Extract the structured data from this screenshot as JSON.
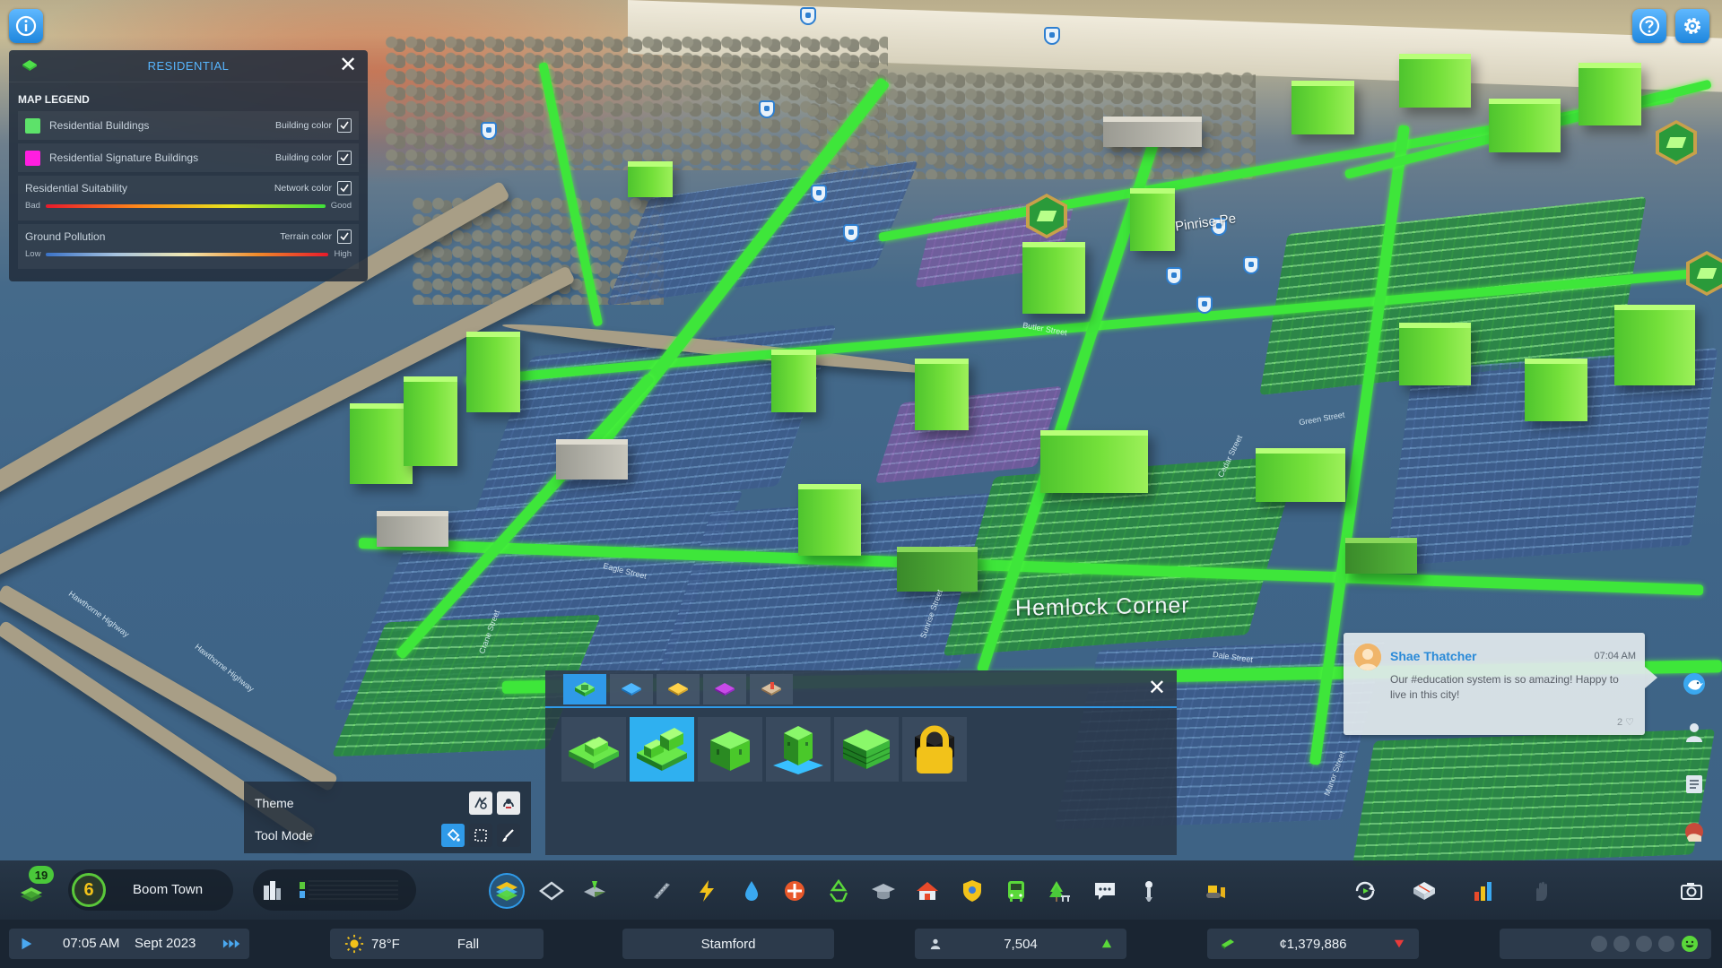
{
  "top_buttons": {
    "info_icon": "info-icon",
    "help_icon": "help-icon",
    "settings_icon": "gear-icon"
  },
  "legend": {
    "title": "RESIDENTIAL",
    "subtitle": "MAP LEGEND",
    "rows": [
      {
        "label": "Residential Buildings",
        "mode": "Building color",
        "color": "#5de26a",
        "checked": true
      },
      {
        "label": "Residential Signature Buildings",
        "mode": "Building color",
        "color": "#ff1ee0",
        "checked": true
      }
    ],
    "gradients": [
      {
        "label": "Residential Suitability",
        "mode": "Network color",
        "low": "Bad",
        "high": "Good",
        "checked": true
      },
      {
        "label": "Ground Pollution",
        "mode": "Terrain color",
        "low": "Low",
        "high": "High",
        "checked": true
      }
    ]
  },
  "map": {
    "district_name": "Hemlock Corner",
    "district_name_2": "Pinrise Pe",
    "streets": [
      "Hawthorne Highway",
      "Hawthorne Highway",
      "Eagle Street",
      "Crane Street",
      "Sunrise Street",
      "Dale Street",
      "Manor Street",
      "Green Street",
      "Butler Street",
      "Cedar Street"
    ]
  },
  "zone_panel": {
    "tabs": [
      "residential-zone-tab",
      "commercial-zone-tab",
      "industrial-zone-tab",
      "office-zone-tab",
      "special-zone-tab"
    ],
    "active_tab": 0,
    "items": [
      "low-density-housing",
      "medium-density-housing",
      "medium-density-row-housing",
      "mixed-housing",
      "high-density-housing",
      "locked-housing"
    ],
    "active_item": 1
  },
  "tool_options": {
    "theme_label": "Theme",
    "tool_mode_label": "Tool Mode"
  },
  "chirp": {
    "name": "Shae Thatcher",
    "time": "07:04 AM",
    "message": "Our #education system is so amazing! Happy to live in this city!",
    "likes": "2"
  },
  "toolbar": {
    "notification_count": "19",
    "milestone_level": "6",
    "milestone_name": "Boom Town"
  },
  "status": {
    "time": "07:05 AM",
    "date": "Sept 2023",
    "temperature": "78°F",
    "season": "Fall",
    "city_name": "Stamford",
    "population": "7,504",
    "money": "¢1,379,886"
  }
}
